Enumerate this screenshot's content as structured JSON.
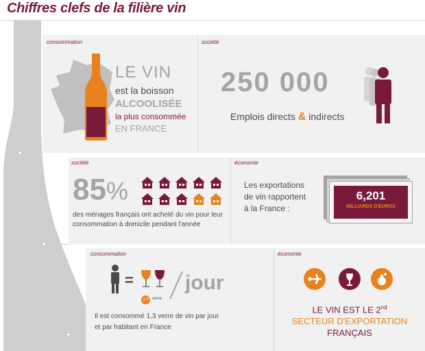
{
  "title": "Chiffres clefs de la filière vin",
  "colors": {
    "wine": "#7a1a3a",
    "orange": "#e8821e",
    "gray": "#a6a3a2",
    "dark_text": "#4a4a4a",
    "panel": "#f1f1f1"
  },
  "panel1": {
    "category": "consommation",
    "line1": "LE VIN",
    "line2": "est la boisson",
    "line3": "ALCOOLISÉE",
    "line4": "la plus consommée",
    "line5": "EN FRANCE",
    "icons": [
      "france-map-icon",
      "wine-bottle-icon"
    ]
  },
  "panel2": {
    "category": "société",
    "number": "250 000",
    "label_a": "Emplois directs",
    "label_amp": "&",
    "label_b": "indirects",
    "icons": [
      "people-crowd-icon"
    ]
  },
  "panel3": {
    "category": "société",
    "percent": "85",
    "percent_sign": "%",
    "text_line1": "des ménages français ont acheté du vin pour leur",
    "text_line2": "consommation à domicile pendant l'année",
    "houses_total": 10,
    "houses_highlighted": 8
  },
  "panel4": {
    "category": "économie",
    "text_line1": "Les exportations",
    "text_line2": "de vin rapportent",
    "text_line3": "à la France :",
    "amount": "6,201",
    "unit": "MILLIARDS D'EUROS"
  },
  "panel5": {
    "category": "consommation",
    "equals": "=",
    "glass_count": "1,3",
    "glass_word": "verre",
    "per": "jour",
    "text_line1": "Il est consommé 1,3 verre de vin par jour",
    "text_line2": "et par habitant en France"
  },
  "panel6": {
    "category": "économie",
    "line1": "LE VIN EST LE 2",
    "superscript": "nd",
    "line2": "SECTEUR D'EXPORTATION",
    "line3": "FRANÇAIS",
    "icons": [
      "airplane-icon",
      "wine-glass-icon",
      "perfume-icon"
    ]
  }
}
